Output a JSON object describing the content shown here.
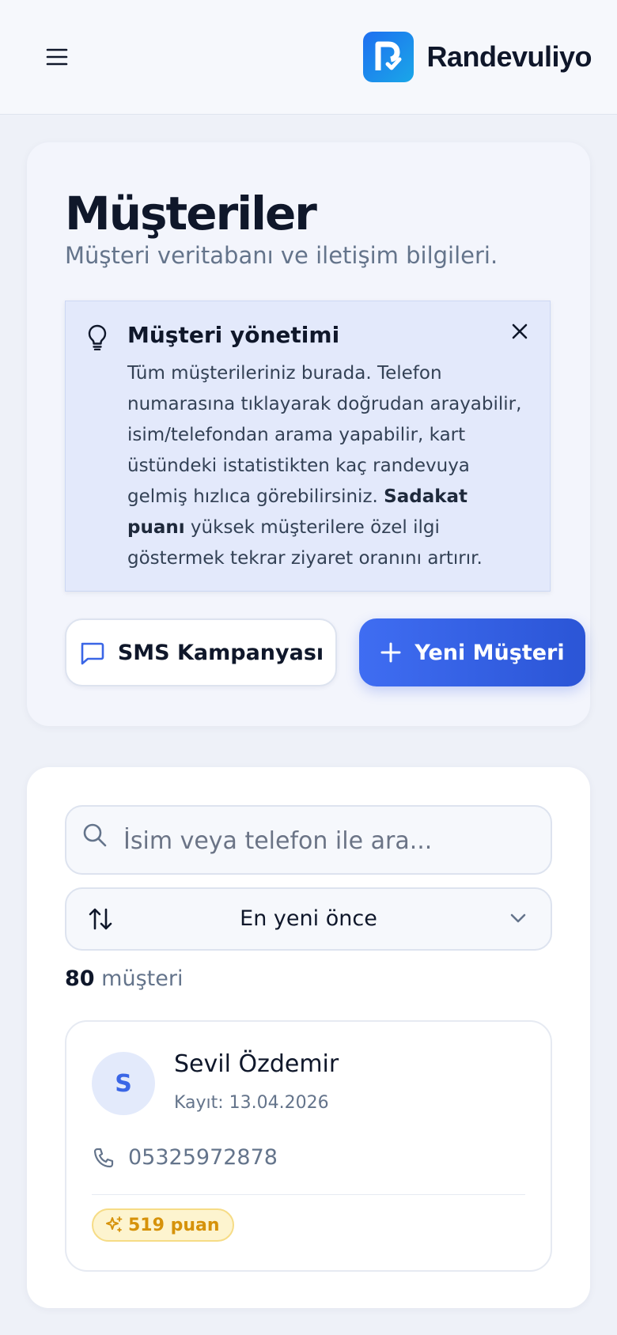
{
  "header": {
    "brand": "Randevuliyo",
    "logo_letter": "R"
  },
  "page": {
    "title": "Müşteriler",
    "subtitle": "Müşteri veritabanı ve iletişim bilgileri."
  },
  "tip": {
    "title": "Müşteri yönetimi",
    "body_before": "Tüm müşterileriniz burada. Telefon numarasına tıklayarak doğrudan arayabilir, isim/telefondan arama yapabilir, kart üstündeki istatistikten kaç randevuya gelmiş hızlıca görebilirsiniz. ",
    "body_bold": "Sadakat puanı",
    "body_after": " yüksek müşterilere özel ilgi göstermek tekrar ziyaret oranını artırır."
  },
  "actions": {
    "sms_label": "SMS Kampanyası",
    "new_customer_label": "Yeni Müşteri"
  },
  "search": {
    "placeholder": "İsim veya telefon ile ara...",
    "value": ""
  },
  "sort": {
    "selected": "En yeni önce"
  },
  "count": {
    "number": "80",
    "label": "müşteri"
  },
  "customers": [
    {
      "initial": "S",
      "name": "Sevil Özdemir",
      "registered": "Kayıt: 13.04.2026",
      "phone": "05325972878",
      "points": "519 puan"
    }
  ],
  "colors": {
    "accent": "#3a66e6",
    "background": "#eef1f8",
    "points_text": "#d6920a",
    "points_bg": "#fdf4cf"
  },
  "icons": [
    "menu-icon",
    "logo-icon",
    "lightbulb-icon",
    "close-icon",
    "message-icon",
    "plus-icon",
    "search-icon",
    "sort-icon",
    "chevron-down-icon",
    "phone-icon",
    "sparkles-icon"
  ]
}
